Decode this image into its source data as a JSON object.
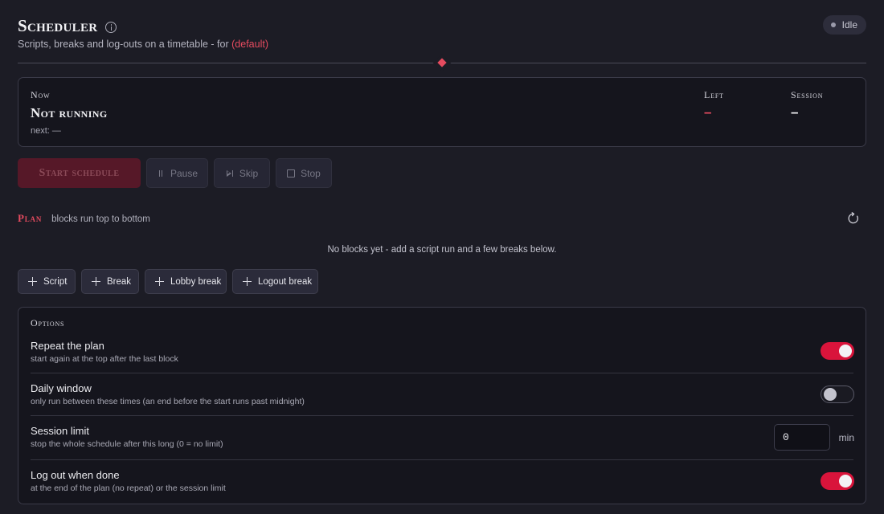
{
  "header": {
    "title": "Scheduler",
    "subtitle_prefix": "Scripts, breaks and log-outs on a timetable - for",
    "profile": "(default)",
    "status": "Idle"
  },
  "now": {
    "label": "Now",
    "value": "Not running",
    "next": "next: —",
    "left_label": "Left",
    "left_value": "–",
    "session_label": "Session",
    "session_value": "–"
  },
  "controls": {
    "start": "Start schedule",
    "pause": "Pause",
    "skip": "Skip",
    "stop": "Stop"
  },
  "plan": {
    "title": "Plan",
    "hint": "blocks run top to bottom",
    "empty": "No blocks yet - add a script run and a few breaks below.",
    "add_buttons": {
      "script": "Script",
      "break": "Break",
      "lobby_break": "Lobby break",
      "logout_break": "Logout break"
    }
  },
  "options": {
    "title": "Options",
    "repeat": {
      "name": "Repeat the plan",
      "desc": "start again at the top after the last block",
      "enabled": true
    },
    "daily_window": {
      "name": "Daily window",
      "desc": "only run between these times (an end before the start runs past midnight)",
      "enabled": false
    },
    "session_limit": {
      "name": "Session limit",
      "desc": "stop the whole schedule after this long (0 = no limit)",
      "value": "0",
      "unit": "min"
    },
    "logout_done": {
      "name": "Log out when done",
      "desc": "at the end of the plan (no repeat) or the session limit",
      "enabled": true
    }
  },
  "colors": {
    "accent": "#e64b5f",
    "toggle_on": "#d9143b",
    "background": "#1c1c25",
    "card": "#15151d"
  }
}
